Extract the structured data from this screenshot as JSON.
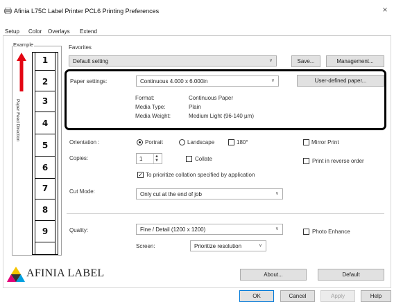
{
  "window": {
    "title": "Afinia L75C Label Printer PCL6 Printing Preferences",
    "close_label": "×"
  },
  "tabs": [
    "Setup",
    "Color",
    "Overlays",
    "Extend"
  ],
  "example": {
    "label": "Example",
    "feed_direction": "Paper Feed Direction",
    "labels": [
      "1",
      "2",
      "3",
      "4",
      "5",
      "6",
      "7",
      "8",
      "9"
    ]
  },
  "favorites": {
    "label": "Favorites",
    "value": "Default setting",
    "save": "Save...",
    "management": "Management..."
  },
  "paper": {
    "label": "Paper settings:",
    "value": "Continuous 4.000 x 6.000in",
    "user_defined": "User-defined paper...",
    "details": [
      {
        "key": "Format:",
        "value": "Continuous Paper"
      },
      {
        "key": "Media Type:",
        "value": "Plain"
      },
      {
        "key": "Media Weight:",
        "value": "Medium Light (96-140 µm)"
      }
    ]
  },
  "orientation": {
    "label": "Orientation :",
    "portrait": "Portrait",
    "landscape": "Landscape",
    "rotate180": "180°",
    "selected": "Portrait"
  },
  "mirror_print": "Mirror Print",
  "copies": {
    "label": "Copies:",
    "value": "1",
    "collate": "Collate",
    "prioritize": "To prioritize collation specified by application",
    "reverse": "Print in reverse order"
  },
  "cut_mode": {
    "label": "Cut Mode:",
    "value": "Only cut at the end of job"
  },
  "quality": {
    "label": "Quality:",
    "value": "Fine / Detail (1200 x 1200)",
    "photo_enhance": "Photo Enhance",
    "screen_label": "Screen:",
    "screen_value": "Prioritize resolution"
  },
  "brand": "AFINIA LABEL",
  "buttons": {
    "about": "About...",
    "default": "Default",
    "ok": "OK",
    "cancel": "Cancel",
    "apply": "Apply",
    "help": "Help"
  },
  "colors": {
    "highlight_border": "#000000",
    "logo_yellow": "#f5c400",
    "logo_magenta": "#e2007a",
    "logo_cyan": "#00a0e0",
    "arrow_red": "#e30613"
  }
}
